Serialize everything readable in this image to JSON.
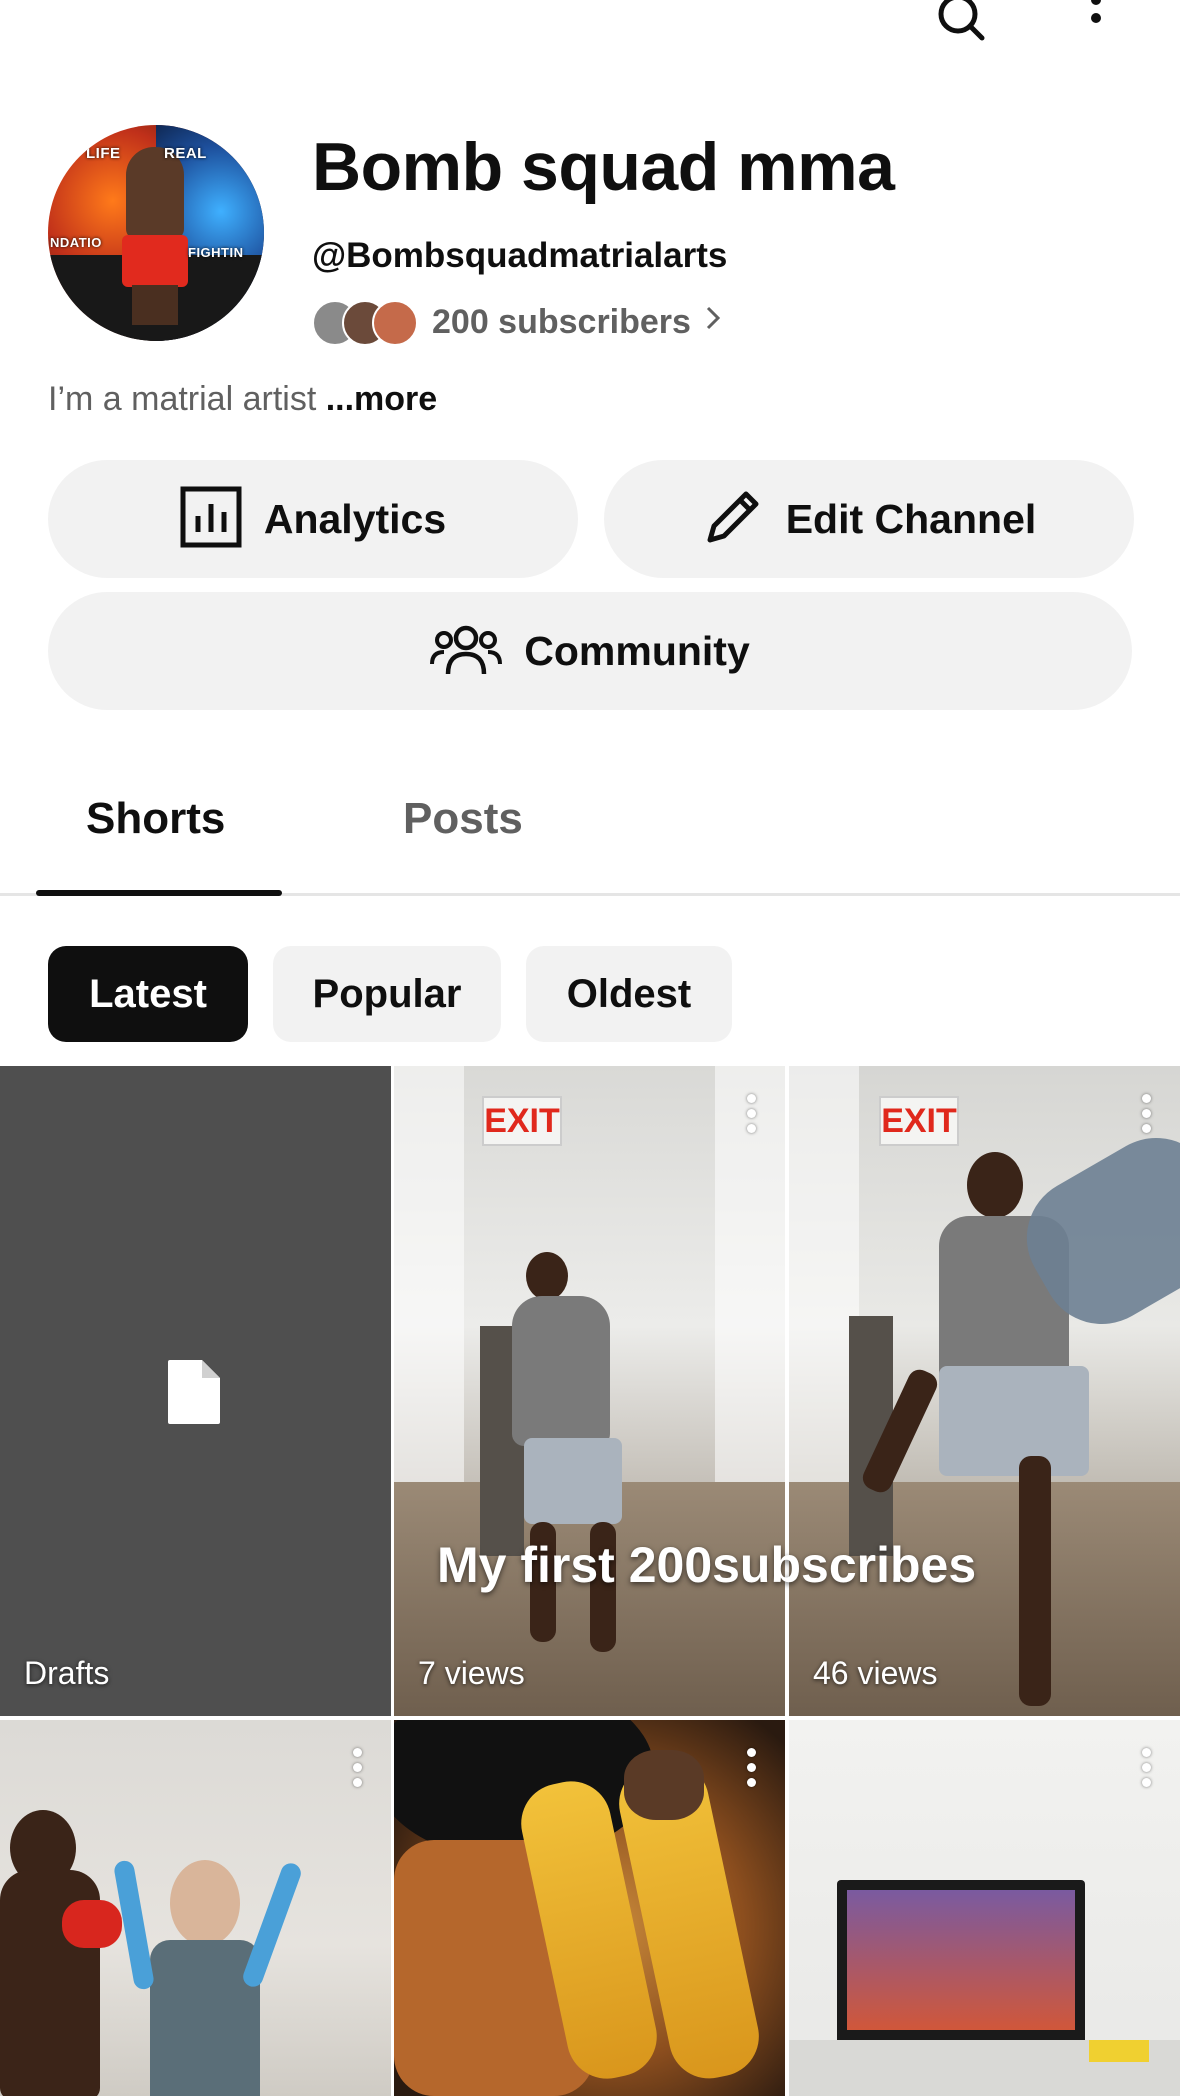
{
  "channel": {
    "name": "Bomb squad mma",
    "handle": "@Bombsquadmatrialarts",
    "subscribers": "200 subscribers",
    "bio": "I’m a matrial artist",
    "bio_more": "...more",
    "avatar_text_left": "LIFE",
    "avatar_text_right": "REAL",
    "avatar_text_mid_left": "NDATIO",
    "avatar_text_mid_right": "FIGHTIN"
  },
  "buttons": {
    "analytics": "Analytics",
    "edit_channel": "Edit Channel",
    "community": "Community"
  },
  "tabs": [
    "Shorts",
    "Posts"
  ],
  "active_tab": "Shorts",
  "filters": [
    "Latest",
    "Popular",
    "Oldest"
  ],
  "active_filter": "Latest",
  "shorts": [
    {
      "label": "Drafts",
      "type": "drafts"
    },
    {
      "label": "7 views",
      "type": "video"
    },
    {
      "label": "46 views",
      "type": "video"
    },
    {
      "label": "",
      "type": "video"
    },
    {
      "label": "",
      "type": "video"
    },
    {
      "label": "",
      "type": "video"
    }
  ],
  "overlay_caption": "My first 200subscribes",
  "exit_sign": "EXIT",
  "icons": [
    "search-icon",
    "more-vert-icon",
    "chevron-right-icon",
    "bar-chart-icon",
    "pencil-icon",
    "people-icon",
    "document-icon"
  ],
  "colors": {
    "text_primary": "#0f0f0f",
    "text_secondary": "#606060",
    "chip_bg": "#f2f2f2",
    "chip_active_bg": "#0f0f0f",
    "drafts_bg": "#4f4f4f"
  }
}
